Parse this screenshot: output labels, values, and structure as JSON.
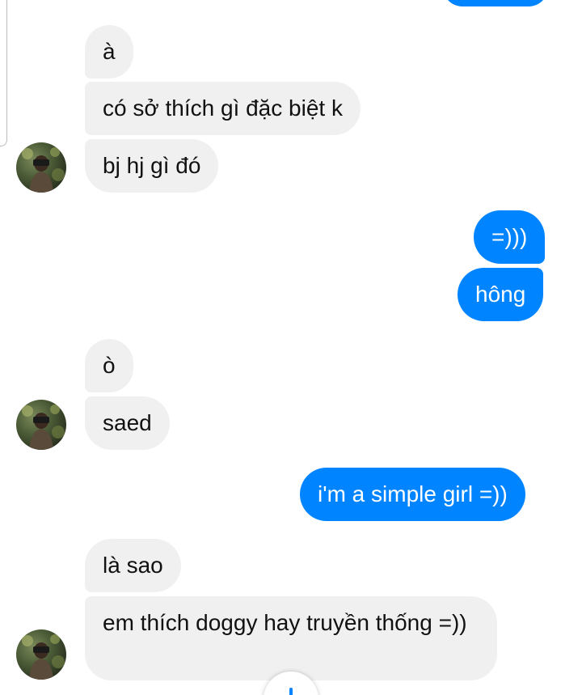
{
  "conversation": {
    "messages": [
      {
        "id": "m1",
        "sender": "them",
        "text": "à"
      },
      {
        "id": "m2",
        "sender": "them",
        "text": "có sở thích gì đặc biệt k"
      },
      {
        "id": "m3",
        "sender": "them",
        "text": "bj hj gì đó"
      },
      {
        "id": "m4",
        "sender": "me",
        "text": "=)))"
      },
      {
        "id": "m5",
        "sender": "me",
        "text": "hông"
      },
      {
        "id": "m6",
        "sender": "them",
        "text": "ò"
      },
      {
        "id": "m7",
        "sender": "them",
        "text": "saed"
      },
      {
        "id": "m8",
        "sender": "me",
        "text": "i'm a simple girl =))"
      },
      {
        "id": "m9",
        "sender": "them",
        "text": "là sao"
      },
      {
        "id": "m10",
        "sender": "them",
        "text": "em thích doggy hay truyền thống =))"
      }
    ]
  },
  "colors": {
    "outgoing_bubble": "#0084ff",
    "incoming_bubble": "#f1f0f0",
    "outgoing_text": "#ffffff",
    "incoming_text": "#111111"
  },
  "icons": {
    "contact_avatar": "contact-avatar",
    "scroll_down": "arrow-down-icon"
  }
}
